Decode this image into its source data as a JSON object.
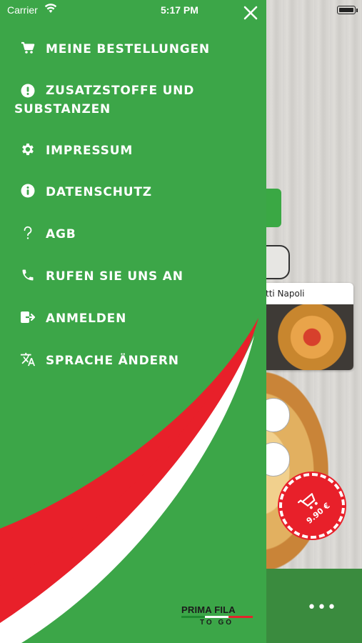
{
  "status_bar": {
    "carrier": "Carrier",
    "time": "5:17 PM"
  },
  "drawer": {
    "menu_items": [
      {
        "label": "MEINE BESTELLUNGEN",
        "icon": "cart-icon"
      },
      {
        "label": "ZUSATZSTOFFE UND SUBSTANZEN",
        "icon": "exclamation-circle-icon"
      },
      {
        "label": "IMPRESSUM",
        "icon": "gear-icon"
      },
      {
        "label": "DATENSCHUTZ",
        "icon": "info-circle-icon"
      },
      {
        "label": "AGB",
        "icon": "question-icon"
      },
      {
        "label": "RUFEN SIE UNS AN",
        "icon": "phone-icon"
      },
      {
        "label": "ANMELDEN",
        "icon": "sign-in-icon"
      },
      {
        "label": "SPRACHE ÄNDERN",
        "icon": "translate-icon"
      }
    ],
    "logo": {
      "line1": "PRIMA FILA",
      "line2": "TO GO"
    }
  },
  "background": {
    "card_title": "tti Napoli",
    "cart_total": "9.90 €",
    "more_icon": "ellipsis-icon"
  },
  "colors": {
    "drawer_green": "#3ca648",
    "accent_red": "#e8202a",
    "white": "#ffffff"
  }
}
